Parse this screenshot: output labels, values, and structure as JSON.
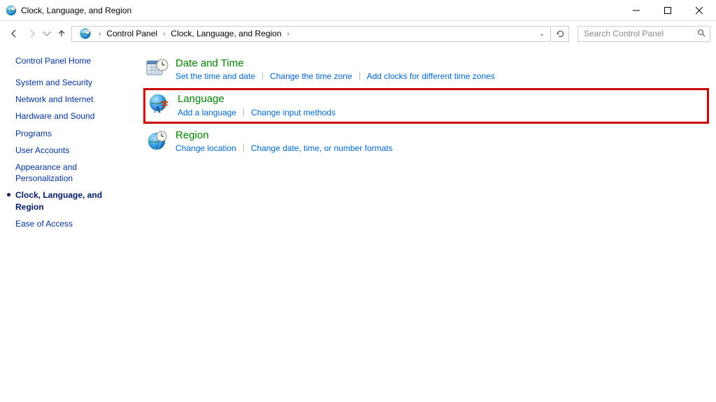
{
  "window": {
    "title": "Clock, Language, and Region"
  },
  "breadcrumbs": {
    "root_chevron": "›",
    "items": [
      "Control Panel",
      "Clock, Language, and Region"
    ],
    "dropdown_glyph": "⌄"
  },
  "search": {
    "placeholder": "Search Control Panel"
  },
  "sidebar": {
    "home": "Control Panel Home",
    "items": [
      {
        "label": "System and Security",
        "active": false
      },
      {
        "label": "Network and Internet",
        "active": false
      },
      {
        "label": "Hardware and Sound",
        "active": false
      },
      {
        "label": "Programs",
        "active": false
      },
      {
        "label": "User Accounts",
        "active": false
      },
      {
        "label": "Appearance and Personalization",
        "active": false
      },
      {
        "label": "Clock, Language, and Region",
        "active": true
      },
      {
        "label": "Ease of Access",
        "active": false
      }
    ]
  },
  "categories": [
    {
      "title": "Date and Time",
      "highlighted": false,
      "links": [
        "Set the time and date",
        "Change the time zone",
        "Add clocks for different time zones"
      ]
    },
    {
      "title": "Language",
      "highlighted": true,
      "links": [
        "Add a language",
        "Change input methods"
      ]
    },
    {
      "title": "Region",
      "highlighted": false,
      "links": [
        "Change location",
        "Change date, time, or number formats"
      ]
    }
  ]
}
